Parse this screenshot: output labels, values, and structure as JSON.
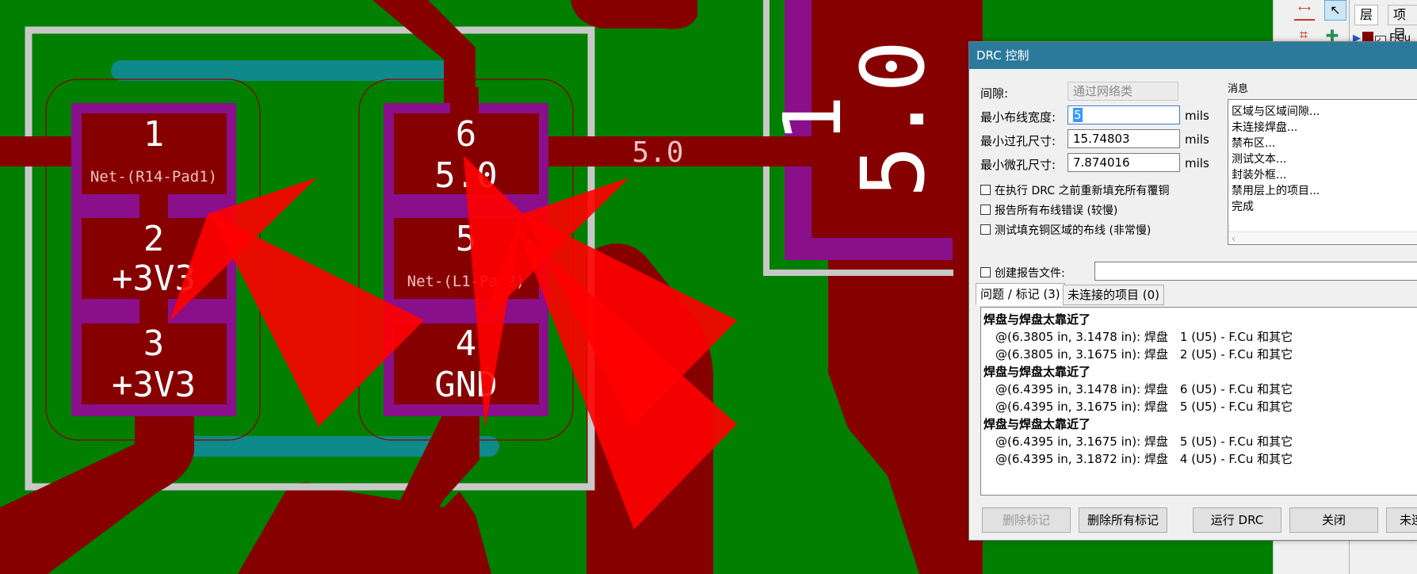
{
  "pcb": {
    "pads": [
      {
        "num": "1",
        "net": "Net-(R14-Pad1)"
      },
      {
        "num": "2",
        "net": "+3V3"
      },
      {
        "num": "3",
        "net": "+3V3"
      },
      {
        "num": "6",
        "net": "5.0"
      },
      {
        "num": "5",
        "net": "Net-(L1-Pad2)"
      },
      {
        "num": "4",
        "net": "GND"
      }
    ],
    "track_label": "5.0",
    "big_label_1": "1",
    "big_label_2": "5.0",
    "colors": {
      "board": "#007f00",
      "copper": "#870000",
      "mask": "#8a0f8a",
      "silk": "#c8c8c8",
      "teal": "#0e8a8a",
      "marker": "#ff0000"
    }
  },
  "panel": {
    "tabs": [
      "层",
      "项目"
    ],
    "layer_label": "F.Cu"
  },
  "drc": {
    "title": "DRC 控制",
    "clearance_label": "间隙:",
    "clearance_value": "通过网络类",
    "min_track_label": "最小布线宽度:",
    "min_track_value": "5",
    "min_via_label": "最小过孔尺寸:",
    "min_via_value": "15.74803",
    "min_microvia_label": "最小微孔尺寸:",
    "min_microvia_value": "7.874016",
    "unit": "mils",
    "options": [
      "在执行 DRC 之前重新填充所有覆铜",
      "报告所有布线错误 (较慢)",
      "测试填充铜区域的布线 (非常慢)"
    ],
    "report_label": "创建报告文件:",
    "messages_label": "消息",
    "messages": [
      "区域与区域间隙...",
      "未连接焊盘...",
      "禁布区...",
      "测试文本...",
      "封装外框...",
      "禁用层上的项目...",
      "完成"
    ],
    "tabs": [
      "问题 / 标记 (3)",
      "未连接的项目 (0)"
    ],
    "problems": [
      {
        "title": "焊盘与焊盘太靠近了",
        "items": [
          "@(6.3805 in, 3.1478 in): 焊盘　1 (U5) - F.Cu 和其它",
          "@(6.3805 in, 3.1675 in): 焊盘　2 (U5) - F.Cu 和其它"
        ]
      },
      {
        "title": "焊盘与焊盘太靠近了",
        "items": [
          "@(6.4395 in, 3.1478 in): 焊盘　6 (U5) - F.Cu 和其它",
          "@(6.4395 in, 3.1675 in): 焊盘　5 (U5) - F.Cu 和其它"
        ]
      },
      {
        "title": "焊盘与焊盘太靠近了",
        "items": [
          "@(6.4395 in, 3.1675 in): 焊盘　5 (U5) - F.Cu 和其它",
          "@(6.4395 in, 3.1872 in): 焊盘　4 (U5) - F.Cu 和其它"
        ]
      }
    ],
    "buttons": {
      "delete_marker": "删除标记",
      "delete_all": "删除所有标记",
      "run": "运行 DRC",
      "close": "关闭",
      "unconnected": "未连"
    }
  }
}
